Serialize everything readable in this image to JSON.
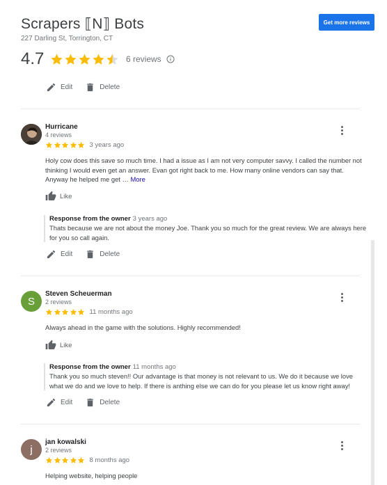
{
  "business": {
    "name": "Scrapers ⟦N⟧ Bots",
    "address": "227 Darling St, Torrington, CT",
    "rating": "4.7",
    "review_count": "6 reviews"
  },
  "buttons": {
    "get_more_reviews": "Get more reviews"
  },
  "top_actions": {
    "edit": "Edit",
    "delete": "Delete"
  },
  "reviews": [
    {
      "name": "Hurricane",
      "count": "4 reviews",
      "ago": "3 years ago",
      "text": "Holy cow does this save so much time. I had a issue as I am not very computer savvy. I called the number not thinking I would even get an answer. Evan got right back to me. How many online vendors can say that. Anyway he helped me get …",
      "more": "More",
      "like": "Like",
      "owner_label": "Response from the owner",
      "owner_ago": "3 years ago",
      "owner_text": "Thats because we are not about the money Joe. Thank you so much for the great review. We are always here for you so call again.",
      "edit": "Edit",
      "delete": "Delete"
    },
    {
      "name": "Steven Scheuerman",
      "initial": "S",
      "count": "2 reviews",
      "ago": "11 months ago",
      "text": "Always ahead in the game with the solutions. Highly recommended!",
      "like": "Like",
      "owner_label": "Response from the owner",
      "owner_ago": "11 months ago",
      "owner_text": "Thank you so much steven!! Our advantage is that money is not relevant to us. We do it because we love what we do and we love to help. If there is anthing else we can do for you please let us know right away!",
      "edit": "Edit",
      "delete": "Delete"
    },
    {
      "name": "jan kowalski",
      "initial": "j",
      "count": "2 reviews",
      "ago": "8 months ago",
      "text": "Helping website, helping people"
    }
  ],
  "colors": {
    "star": "#fbbc04",
    "accent": "#1a73e8",
    "avatar_s": "#689f38",
    "avatar_j": "#8d6e63"
  }
}
